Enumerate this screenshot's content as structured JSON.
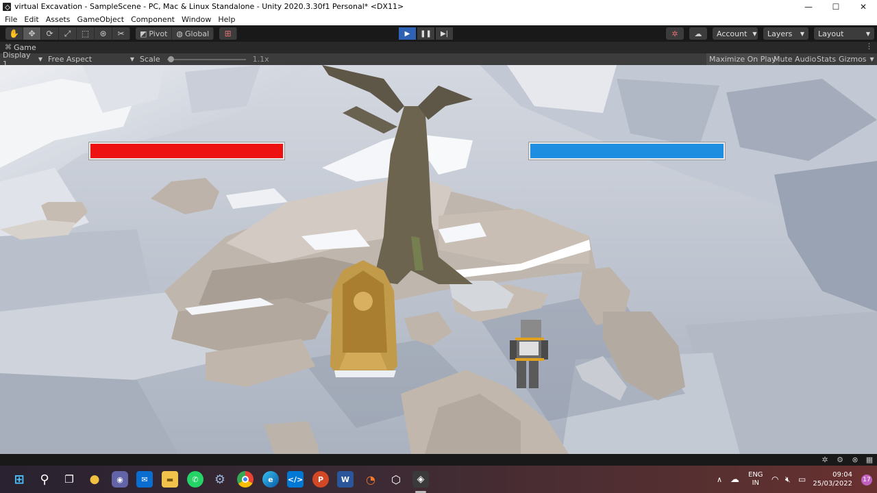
{
  "window": {
    "title": "virtual Excavation - SampleScene - PC, Mac & Linux Standalone - Unity 2020.3.30f1 Personal* <DX11>",
    "controls": {
      "minimize": "—",
      "maximize": "☐",
      "close": "✕"
    }
  },
  "menu": [
    "File",
    "Edit",
    "Assets",
    "GameObject",
    "Component",
    "Window",
    "Help"
  ],
  "toolbar": {
    "pivot_label": "Pivot",
    "global_label": "Global",
    "account_label": "Account",
    "layers_label": "Layers",
    "layout_label": "Layout"
  },
  "game_view": {
    "tab_label": "Game",
    "display_label": "Display 1",
    "aspect_label": "Free Aspect",
    "scale_label": "Scale",
    "scale_value": "1.1x",
    "maximize_label": "Maximize On Play",
    "mute_label": "Mute Audio",
    "stats_label": "Stats",
    "gizmos_label": "Gizmos"
  },
  "hud": {
    "left_bar_color": "#ee1111",
    "right_bar_color": "#1e8ee0",
    "left_bar_fill": 1.0,
    "right_bar_fill": 1.0
  },
  "taskbar": {
    "apps": [
      "windows-start",
      "search",
      "task-view",
      "widgets",
      "teams-chat",
      "mail",
      "file-explorer",
      "whatsapp",
      "settings",
      "chrome",
      "edge",
      "vscode",
      "powerpoint",
      "word",
      "blender",
      "unity-hub",
      "unity"
    ],
    "language_line1": "ENG",
    "language_line2": "IN",
    "time": "09:04",
    "date": "25/03/2022",
    "notification_count": "17"
  }
}
